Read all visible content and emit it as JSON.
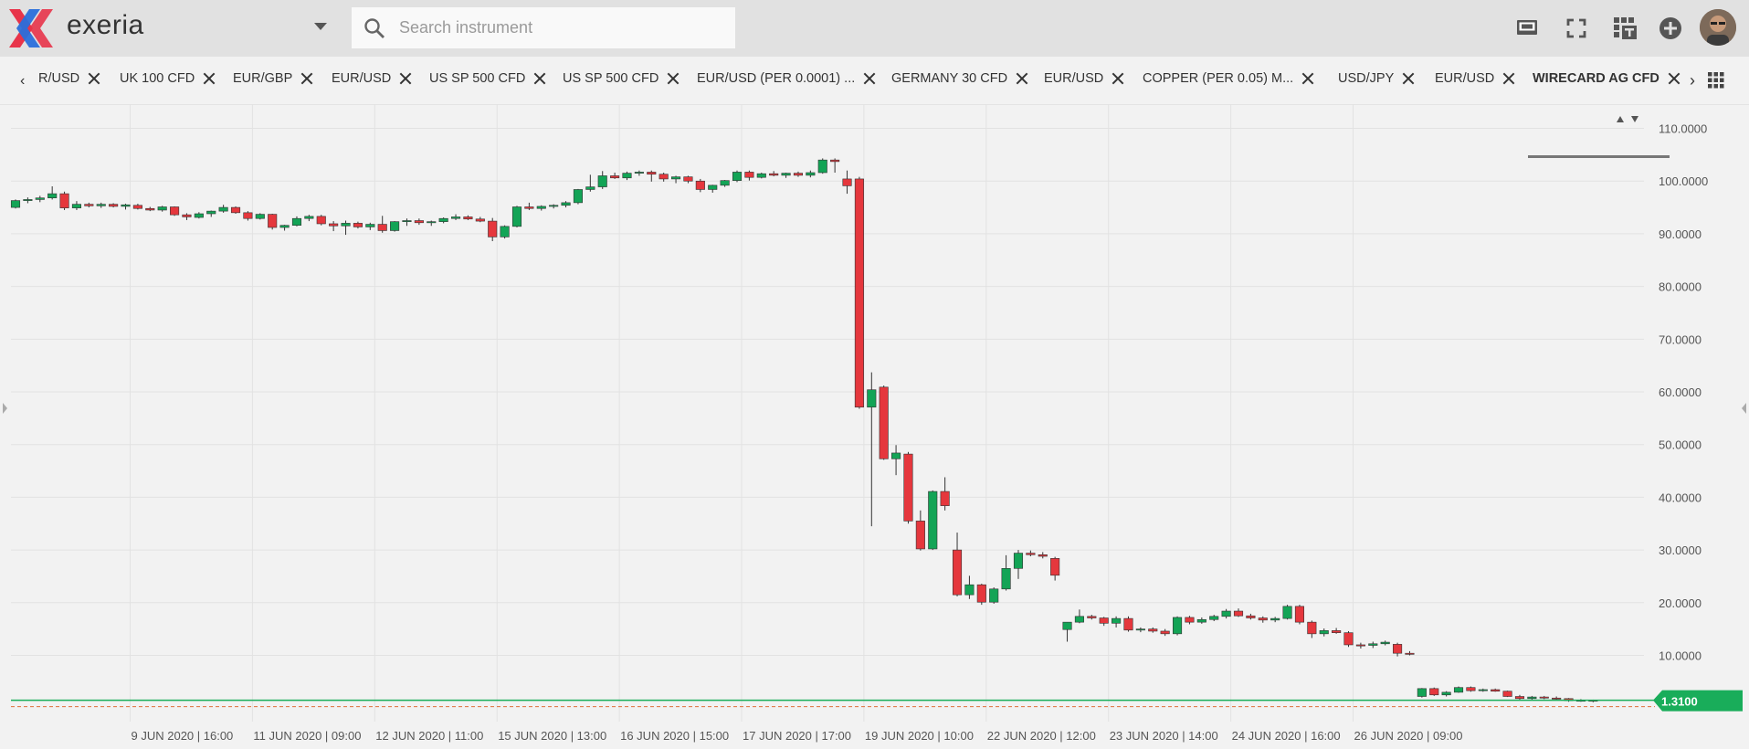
{
  "app": {
    "name": "exeria"
  },
  "search": {
    "placeholder": "Search instrument"
  },
  "toolbar_icons": [
    "monitor-icon",
    "fullscreen-icon",
    "widget-grid-icon",
    "add-circle-icon"
  ],
  "tabs": [
    {
      "label": "R/USD"
    },
    {
      "label": "UK 100 CFD"
    },
    {
      "label": "EUR/GBP"
    },
    {
      "label": "EUR/USD"
    },
    {
      "label": "US SP 500 CFD"
    },
    {
      "label": "US SP 500 CFD"
    },
    {
      "label": "EUR/USD (PER 0.0001) ..."
    },
    {
      "label": "GERMANY 30 CFD"
    },
    {
      "label": "EUR/USD"
    },
    {
      "label": "COPPER (PER 0.05) M..."
    },
    {
      "label": "USD/JPY"
    },
    {
      "label": "EUR/USD"
    },
    {
      "label": "WIRECARD AG CFD",
      "active": true
    }
  ],
  "colors": {
    "up": "#13a456",
    "down": "#e5373d",
    "current_price": "#19ad5a",
    "dashed_line": "#e0703a"
  },
  "chart_data": {
    "type": "candlestick",
    "instrument": "WIRECARD AG CFD",
    "y_ticks": [
      "110.0000",
      "100.0000",
      "90.0000",
      "80.0000",
      "70.0000",
      "60.0000",
      "50.0000",
      "40.0000",
      "30.0000",
      "20.0000",
      "10.0000"
    ],
    "y_tick_values": [
      110,
      100,
      90,
      80,
      70,
      60,
      50,
      40,
      30,
      20,
      10
    ],
    "ylim": [
      -1.7,
      114.6
    ],
    "x_ticks": [
      {
        "label": "9 JUN 2020 | 16:00",
        "index": 9
      },
      {
        "label": "11 JUN 2020 | 09:00",
        "index": 19
      },
      {
        "label": "12 JUN 2020 | 11:00",
        "index": 29
      },
      {
        "label": "15 JUN 2020 | 13:00",
        "index": 39
      },
      {
        "label": "16 JUN 2020 | 15:00",
        "index": 49
      },
      {
        "label": "17 JUN 2020 | 17:00",
        "index": 59
      },
      {
        "label": "19 JUN 2020 | 10:00",
        "index": 69
      },
      {
        "label": "22 JUN 2020 | 12:00",
        "index": 79
      },
      {
        "label": "23 JUN 2020 | 14:00",
        "index": 89
      },
      {
        "label": "24 JUN 2020 | 16:00",
        "index": 99
      },
      {
        "label": "26 JUN 2020 | 09:00",
        "index": 109
      }
    ],
    "current_price": "1.3100",
    "current_price_value": 1.31,
    "candles": [
      [
        95,
        96.5,
        94.8,
        96.3
      ],
      [
        96.3,
        96.9,
        95.8,
        96.5
      ],
      [
        96.5,
        97.2,
        96,
        96.8
      ],
      [
        96.8,
        99,
        96.5,
        97.6
      ],
      [
        97.6,
        98,
        94.5,
        94.9
      ],
      [
        94.9,
        96.2,
        94.5,
        95.6
      ],
      [
        95.6,
        95.9,
        95,
        95.3
      ],
      [
        95.3,
        95.9,
        94.9,
        95.6
      ],
      [
        95.6,
        95.8,
        95,
        95.2
      ],
      [
        95.2,
        95.7,
        94.6,
        95.5
      ],
      [
        95.4,
        95.7,
        94.6,
        94.8
      ],
      [
        94.8,
        95.1,
        94.3,
        94.5
      ],
      [
        94.5,
        95.3,
        94.2,
        95.1
      ],
      [
        95.1,
        95.2,
        93.4,
        93.6
      ],
      [
        93.6,
        93.9,
        92.6,
        93.2
      ],
      [
        93.1,
        94.1,
        92.9,
        93.8
      ],
      [
        93.8,
        94.4,
        93.2,
        94.3
      ],
      [
        94.3,
        95.5,
        94,
        95
      ],
      [
        95,
        95.2,
        93.8,
        94
      ],
      [
        94,
        94.3,
        92.5,
        92.9
      ],
      [
        92.9,
        93.9,
        92.7,
        93.7
      ],
      [
        93.7,
        93.8,
        90.8,
        91.2
      ],
      [
        91.2,
        91.7,
        90.6,
        91.6
      ],
      [
        91.6,
        93.3,
        91.4,
        92.9
      ],
      [
        92.9,
        93.6,
        92.4,
        93.3
      ],
      [
        93.3,
        93.6,
        91.6,
        91.9
      ],
      [
        91.9,
        92.4,
        90.5,
        91.5
      ],
      [
        91.5,
        92.5,
        89.8,
        92
      ],
      [
        92,
        92.3,
        91,
        91.3
      ],
      [
        91.3,
        92.1,
        90.7,
        91.8
      ],
      [
        91.8,
        93.4,
        90.2,
        90.6
      ],
      [
        90.6,
        92.4,
        90.4,
        92.3
      ],
      [
        92.3,
        92.9,
        91.5,
        92.5
      ],
      [
        92.5,
        92.9,
        91.7,
        92.1
      ],
      [
        92.1,
        92.5,
        91.5,
        92.3
      ],
      [
        92.3,
        93.1,
        92,
        92.9
      ],
      [
        92.9,
        93.7,
        92.6,
        93.2
      ],
      [
        93.2,
        93.5,
        92.6,
        92.8
      ],
      [
        92.8,
        93.2,
        92.2,
        92.4
      ],
      [
        92.4,
        93,
        88.6,
        89.4
      ],
      [
        89.4,
        91.6,
        89.1,
        91.4
      ],
      [
        91.4,
        95.3,
        91.2,
        95.1
      ],
      [
        95.1,
        95.9,
        94.5,
        94.8
      ],
      [
        94.8,
        95.4,
        94.4,
        95.2
      ],
      [
        95.2,
        95.6,
        94.8,
        95.4
      ],
      [
        95.4,
        96.2,
        95,
        95.9
      ],
      [
        95.9,
        98.5,
        95.6,
        98.4
      ],
      [
        98.4,
        101.2,
        98,
        98.9
      ],
      [
        98.9,
        101.9,
        98.5,
        101
      ],
      [
        101,
        101.6,
        100.4,
        100.6
      ],
      [
        100.6,
        101.8,
        100.2,
        101.5
      ],
      [
        101.5,
        102,
        101,
        101.7
      ],
      [
        101.7,
        102,
        99.9,
        101.3
      ],
      [
        101.3,
        101.6,
        99.9,
        100.4
      ],
      [
        100.4,
        101,
        99.6,
        100.8
      ],
      [
        100.8,
        101,
        99.6,
        100
      ],
      [
        100,
        100.4,
        97.9,
        98.4
      ],
      [
        98.4,
        99.3,
        97.8,
        99.2
      ],
      [
        99.2,
        100.2,
        98.9,
        100.1
      ],
      [
        100.1,
        102,
        99.8,
        101.7
      ],
      [
        101.7,
        102,
        100.1,
        100.7
      ],
      [
        100.7,
        101.6,
        100.5,
        101.4
      ],
      [
        101.4,
        101.9,
        100.9,
        101.1
      ],
      [
        101.1,
        101.6,
        100.6,
        101.5
      ],
      [
        101.5,
        101.8,
        100.8,
        101.1
      ],
      [
        101.1,
        102,
        100.7,
        101.6
      ],
      [
        101.6,
        104.3,
        101.4,
        104
      ],
      [
        104,
        104.3,
        101.6,
        103.7
      ],
      [
        100.4,
        102,
        97.6,
        99.1
      ],
      [
        100.4,
        100.8,
        56.8,
        57.1
      ],
      [
        57.1,
        63.7,
        34.5,
        60.4
      ],
      [
        60.9,
        61.2,
        47.1,
        47.3
      ],
      [
        47.3,
        49.9,
        44.2,
        48.4
      ],
      [
        48.2,
        48.6,
        35,
        35.5
      ],
      [
        35.5,
        37.5,
        29.9,
        30.2
      ],
      [
        30.2,
        41.3,
        30,
        41.1
      ],
      [
        41.1,
        43.8,
        37.5,
        38.4
      ],
      [
        30,
        33.3,
        21.2,
        21.5
      ],
      [
        21.5,
        25.1,
        20.7,
        23.4
      ],
      [
        23.4,
        23.6,
        19.6,
        20.1
      ],
      [
        20.1,
        22.9,
        19.8,
        22.6
      ],
      [
        22.6,
        29,
        22.3,
        26.5
      ],
      [
        26.5,
        30,
        24.5,
        29.4
      ],
      [
        29.4,
        29.9,
        28.8,
        29.1
      ],
      [
        29.1,
        29.6,
        28.4,
        28.8
      ],
      [
        28.4,
        28.7,
        24.2,
        25.2
      ],
      [
        14.9,
        16.3,
        12.6,
        16.3
      ],
      [
        16.3,
        18.7,
        16.1,
        17.4
      ],
      [
        17.4,
        17.7,
        16.8,
        17.1
      ],
      [
        17.1,
        17.3,
        15.6,
        16.1
      ],
      [
        16.1,
        17.4,
        15.3,
        17
      ],
      [
        17,
        17.4,
        14.5,
        14.8
      ],
      [
        14.8,
        15.3,
        14.4,
        15
      ],
      [
        15,
        15.3,
        14.3,
        14.6
      ],
      [
        14.6,
        15,
        13.7,
        14.1
      ],
      [
        14.1,
        17.4,
        13.8,
        17.2
      ],
      [
        17.2,
        17.5,
        15.9,
        16.3
      ],
      [
        16.3,
        17.2,
        16,
        16.8
      ],
      [
        16.8,
        17.7,
        16.5,
        17.4
      ],
      [
        17.4,
        18.8,
        17,
        18.4
      ],
      [
        18.4,
        18.9,
        17.3,
        17.5
      ],
      [
        17.5,
        17.9,
        16.8,
        17.1
      ],
      [
        17.1,
        17.4,
        16.2,
        16.7
      ],
      [
        16.7,
        17.3,
        16.3,
        17
      ],
      [
        17,
        19.6,
        16.8,
        19.3
      ],
      [
        19.3,
        19.6,
        15.9,
        16.3
      ],
      [
        16.3,
        16.6,
        13.3,
        14.1
      ],
      [
        14.1,
        15.1,
        13.6,
        14.7
      ],
      [
        14.7,
        15.2,
        14.1,
        14.3
      ],
      [
        14.3,
        14.6,
        11.6,
        12
      ],
      [
        12,
        12.4,
        11.3,
        11.9
      ],
      [
        11.9,
        12.6,
        11.4,
        12.2
      ],
      [
        12.2,
        12.8,
        11.9,
        12.5
      ],
      [
        12.1,
        12.4,
        9.8,
        10.4
      ],
      [
        10.4,
        10.8,
        10,
        10.2
      ],
      [
        2.2,
        3.8,
        2,
        3.7
      ],
      [
        3.7,
        3.9,
        2.3,
        2.5
      ],
      [
        2.5,
        3.2,
        2.2,
        3
      ],
      [
        3,
        4.1,
        2.9,
        3.9
      ],
      [
        3.9,
        4.1,
        3.1,
        3.3
      ],
      [
        3.3,
        3.7,
        3.1,
        3.5
      ],
      [
        3.5,
        3.7,
        3.1,
        3.2
      ],
      [
        3.2,
        3.3,
        2.1,
        2.2
      ],
      [
        2.2,
        2.5,
        1.6,
        1.8
      ],
      [
        1.8,
        2.3,
        1.6,
        2.1
      ],
      [
        2.1,
        2.3,
        1.7,
        1.9
      ],
      [
        1.9,
        2.2,
        1.6,
        1.8
      ],
      [
        1.8,
        1.9,
        1.2,
        1.4
      ],
      [
        1.4,
        1.7,
        1.2,
        1.5
      ],
      [
        1.5,
        1.6,
        1.1,
        1.31
      ]
    ]
  }
}
